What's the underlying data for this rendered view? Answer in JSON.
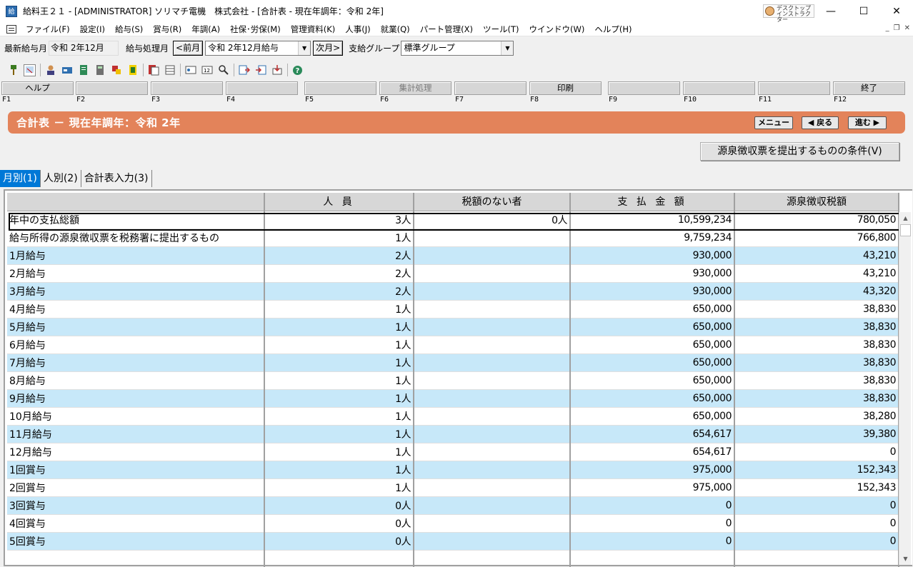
{
  "window": {
    "title": "給料王２１ - [ADMINISTRATOR] ソリマチ電機　株式会社 - [合計表 - 現在年調年：令和 2年]",
    "assistant_label": "デスクトップ インストラクター",
    "minimize": "—",
    "maximize": "☐",
    "close": "✕"
  },
  "menu": {
    "items": [
      "ファイル(F)",
      "設定(I)",
      "給与(S)",
      "賞与(R)",
      "年調(A)",
      "社保･労保(M)",
      "管理資料(K)",
      "人事(J)",
      "就業(Q)",
      "パート管理(X)",
      "ツール(T)",
      "ウインドウ(W)",
      "ヘルプ(H)"
    ],
    "mdi": [
      "_",
      "❐",
      "✕"
    ]
  },
  "monthbar": {
    "latest_label": "最新給与月",
    "latest_value": "令和 2年12月",
    "process_label": "給与処理月",
    "prev_btn": "<前月",
    "process_value": "令和 2年12月給与",
    "next_btn": "次月>",
    "group_label": "支給グループ",
    "group_value": "標準グループ"
  },
  "fkeys": {
    "labels": [
      "ヘルプ",
      "",
      "",
      "",
      "",
      "集計処理",
      "",
      "印刷",
      "",
      "",
      "",
      "終了"
    ],
    "numbers": [
      "F1",
      "F2",
      "F3",
      "F4",
      "F5",
      "F6",
      "F7",
      "F8",
      "F9",
      "F10",
      "F11",
      "F12"
    ]
  },
  "header": {
    "title": "合計表 － 現在年調年：令和 2年",
    "menu_btn": "メニュー",
    "back_btn": "◀ 戻る",
    "next_btn": "進む ▶"
  },
  "condition_btn": "源泉徴収票を提出するものの条件(V)",
  "tabs": [
    "月別(1)",
    "人別(2)",
    "合計表入力(3)"
  ],
  "table": {
    "columns": [
      "",
      "人 員",
      "税額のない者",
      "支 払 金 額",
      "源泉徴収税額"
    ],
    "rows": [
      [
        "年中の支払総額",
        "3人",
        "0人",
        "10,599,234",
        "780,050"
      ],
      [
        "給与所得の源泉徴収票を税務署に提出するもの",
        "1人",
        "",
        "9,759,234",
        "766,800"
      ],
      [
        " 1月給与",
        "2人",
        "",
        "930,000",
        "43,210"
      ],
      [
        " 2月給与",
        "2人",
        "",
        "930,000",
        "43,210"
      ],
      [
        " 3月給与",
        "2人",
        "",
        "930,000",
        "43,320"
      ],
      [
        " 4月給与",
        "1人",
        "",
        "650,000",
        "38,830"
      ],
      [
        " 5月給与",
        "1人",
        "",
        "650,000",
        "38,830"
      ],
      [
        " 6月給与",
        "1人",
        "",
        "650,000",
        "38,830"
      ],
      [
        " 7月給与",
        "1人",
        "",
        "650,000",
        "38,830"
      ],
      [
        " 8月給与",
        "1人",
        "",
        "650,000",
        "38,830"
      ],
      [
        " 9月給与",
        "1人",
        "",
        "650,000",
        "38,830"
      ],
      [
        "10月給与",
        "1人",
        "",
        "650,000",
        "38,280"
      ],
      [
        "11月給与",
        "1人",
        "",
        "654,617",
        "39,380"
      ],
      [
        "12月給与",
        "1人",
        "",
        "654,617",
        "0"
      ],
      [
        " 1回賞与",
        "1人",
        "",
        "975,000",
        "152,343"
      ],
      [
        " 2回賞与",
        "1人",
        "",
        "975,000",
        "152,343"
      ],
      [
        " 3回賞与",
        "0人",
        "",
        "0",
        "0"
      ],
      [
        " 4回賞与",
        "0人",
        "",
        "0",
        "0"
      ],
      [
        " 5回賞与",
        "0人",
        "",
        "0",
        "0"
      ],
      [
        "",
        "",
        "",
        "",
        ""
      ]
    ]
  }
}
